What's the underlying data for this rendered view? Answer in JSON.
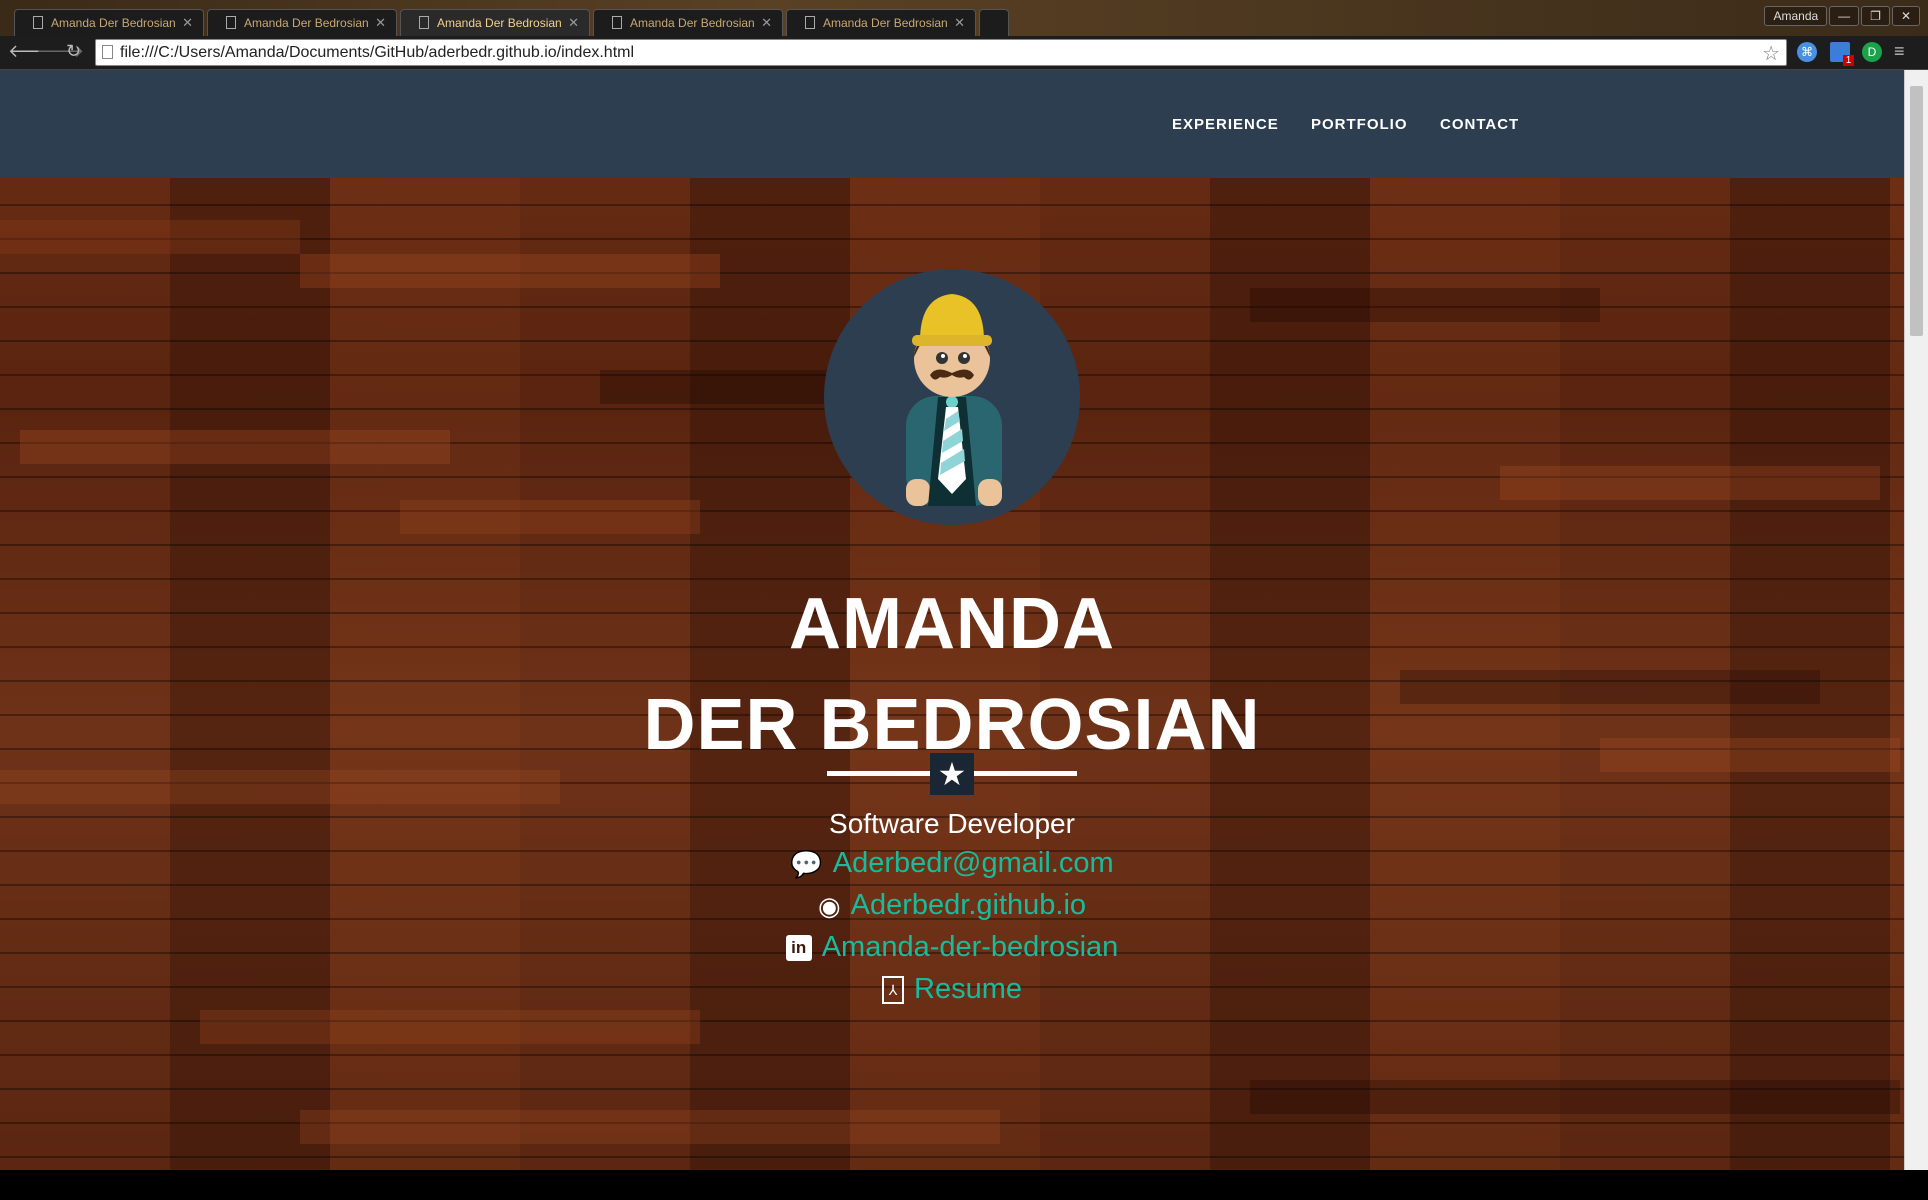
{
  "browser": {
    "tabs": [
      {
        "title": "Amanda Der Bedrosian",
        "active": false
      },
      {
        "title": "Amanda Der Bedrosian",
        "active": false
      },
      {
        "title": "Amanda Der Bedrosian",
        "active": true
      },
      {
        "title": "Amanda Der Bedrosian",
        "active": false
      },
      {
        "title": "Amanda Der Bedrosian",
        "active": false
      }
    ],
    "profile": "Amanda",
    "url": "file:///C:/Users/Amanda/Documents/GitHub/aderbedr.github.io/index.html",
    "extension_badge": "1"
  },
  "nav": {
    "links": [
      "EXPERIENCE",
      "PORTFOLIO",
      "CONTACT"
    ],
    "background": "#2c3e50"
  },
  "hero": {
    "name_line1": "AMANDA",
    "name_line2": "DER BEDROSIAN",
    "divider_icon": "star-icon",
    "role": "Software Developer",
    "links": [
      {
        "icon": "comments-icon",
        "text": "Aderbedr@gmail.com"
      },
      {
        "icon": "github-icon",
        "text": "Aderbedr.github.io"
      },
      {
        "icon": "linkedin-icon",
        "text": "Amanda-der-bedrosian"
      },
      {
        "icon": "file-pdf-icon",
        "text": "Resume"
      }
    ],
    "link_color": "#18bc9c"
  }
}
